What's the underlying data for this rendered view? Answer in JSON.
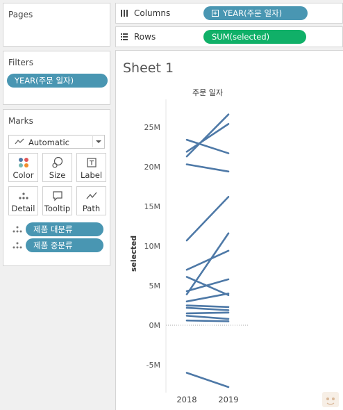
{
  "pages": {
    "title": "Pages"
  },
  "filters": {
    "title": "Filters",
    "pill": "YEAR(주문 일자)"
  },
  "marks": {
    "title": "Marks",
    "type": "Automatic",
    "buttons": [
      "Color",
      "Size",
      "Label",
      "Detail",
      "Tooltip",
      "Path"
    ],
    "fields": [
      "제품 대분류",
      "제품 중분류"
    ]
  },
  "shelves": {
    "columns_label": "Columns",
    "columns_pill": "YEAR(주문 일자)",
    "rows_label": "Rows",
    "rows_pill": "SUM(selected)"
  },
  "sheet": {
    "title": "Sheet 1"
  },
  "colors": {
    "pill_blue": "#4996b2",
    "pill_green": "#10b068",
    "line": "#4e79a7"
  },
  "chart_data": {
    "type": "line",
    "title": "주문 일자",
    "ylabel": "selected",
    "x": [
      "2018",
      "2019"
    ],
    "ylim": [
      -8.5,
      28.5
    ],
    "yticks": [
      -5,
      0,
      5,
      10,
      15,
      20,
      25
    ],
    "ytick_labels": [
      "-5M",
      "0M",
      "5M",
      "10M",
      "15M",
      "20M",
      "25M"
    ],
    "zero_line": true,
    "unit": "M",
    "series": [
      {
        "values": [
          21.3,
          26.6
        ]
      },
      {
        "values": [
          21.9,
          25.4
        ]
      },
      {
        "values": [
          23.4,
          21.7
        ]
      },
      {
        "values": [
          20.3,
          19.4
        ]
      },
      {
        "values": [
          10.7,
          16.2
        ]
      },
      {
        "values": [
          3.9,
          11.6
        ]
      },
      {
        "values": [
          7.0,
          9.4
        ]
      },
      {
        "values": [
          6.1,
          3.8
        ]
      },
      {
        "values": [
          4.3,
          5.8
        ]
      },
      {
        "values": [
          3.0,
          4.0
        ]
      },
      {
        "values": [
          2.5,
          2.3
        ]
      },
      {
        "values": [
          2.2,
          1.9
        ]
      },
      {
        "values": [
          1.5,
          1.6
        ]
      },
      {
        "values": [
          1.2,
          0.8
        ]
      },
      {
        "values": [
          0.6,
          0.5
        ]
      },
      {
        "values": [
          -6.0,
          -7.8
        ]
      }
    ]
  }
}
